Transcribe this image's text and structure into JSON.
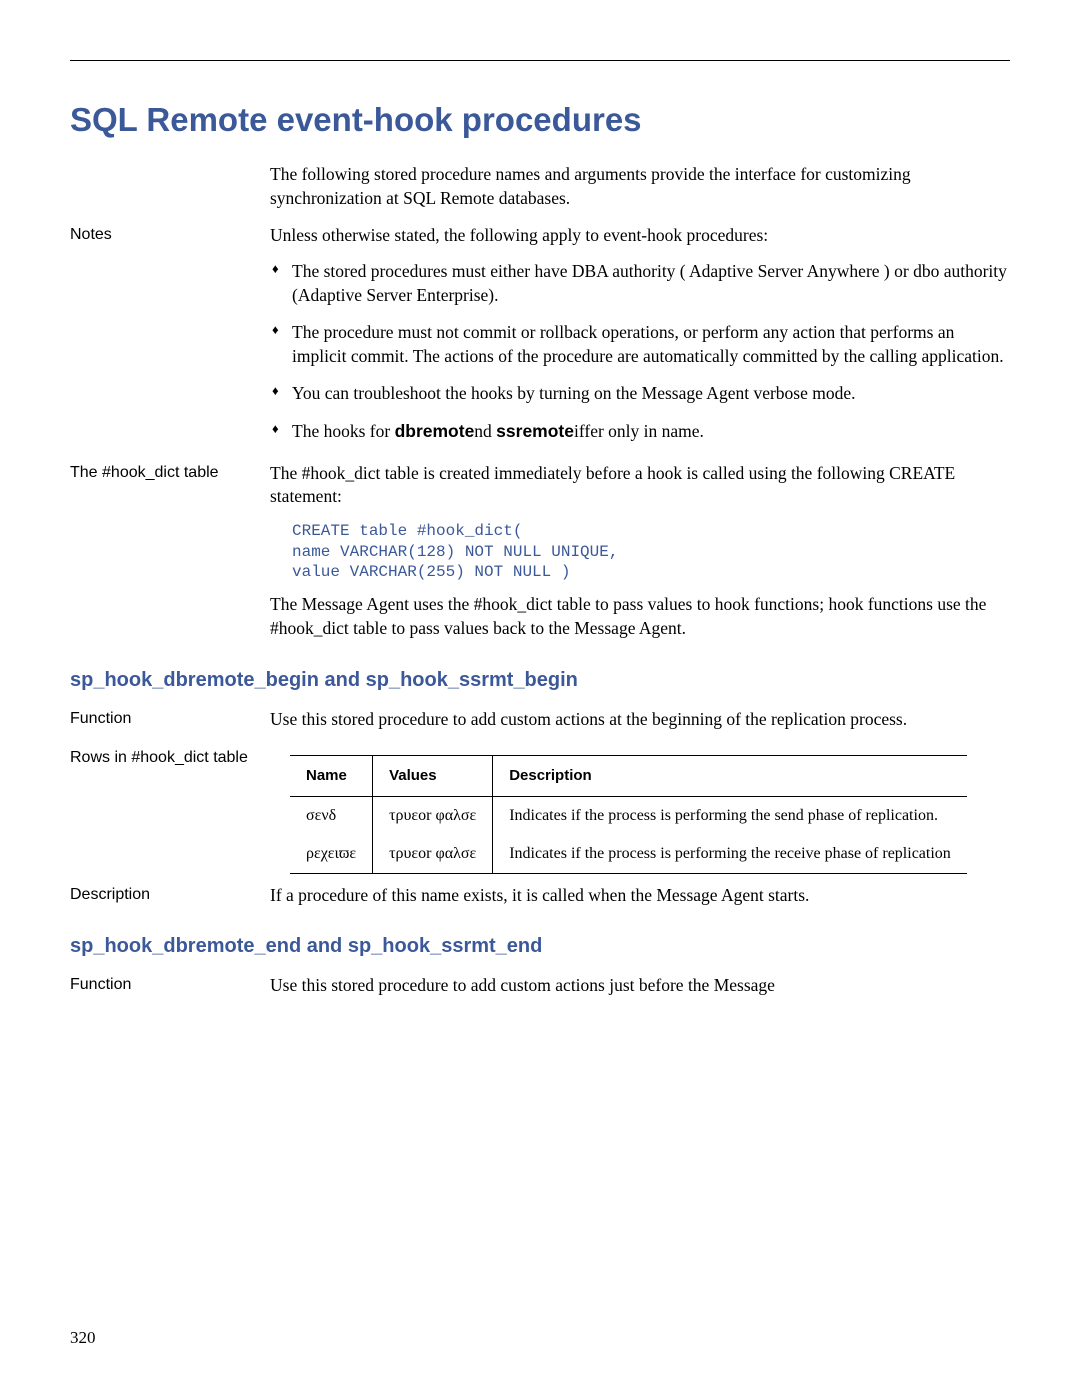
{
  "main_title": "SQL Remote event-hook procedures",
  "intro": "The following stored procedure names and arguments provide the interface for customizing synchronization at SQL Remote databases.",
  "notes": {
    "label": "Notes",
    "lead": "Unless otherwise stated, the following apply to event-hook procedures:",
    "bullets": [
      "The stored procedures must either have DBA authority ( Adaptive Server Anywhere ) or dbo authority (Adaptive Server Enterprise).",
      "The procedure must not commit or rollback operations, or perform any action that performs an implicit commit. The actions of the procedure are automatically committed by the calling application.",
      "You can troubleshoot the hooks by turning on the Message Agent verbose mode."
    ],
    "bullet4_pre": "The hooks for ",
    "bullet4_bold1": "dbremote",
    "bullet4_mid": "nd ",
    "bullet4_bold2": "ssremote",
    "bullet4_post": "iffer only in name."
  },
  "hook_dict": {
    "label": "The #hook_dict table",
    "para1": "The #hook_dict table is created immediately before a hook is called using the following CREATE statement:",
    "code": "CREATE table #hook_dict(\nname VARCHAR(128) NOT NULL UNIQUE,\nvalue VARCHAR(255) NOT NULL )",
    "para2": "The Message Agent uses the #hook_dict table to pass values to hook functions; hook functions use the #hook_dict table to pass values back to the Message Agent."
  },
  "sub1": {
    "title": "sp_hook_dbremote_begin and sp_hook_ssrmt_begin",
    "function_label": "Function",
    "function_text": "Use this stored procedure to add custom actions at the beginning of the replication process.",
    "rows_label": "Rows in #hook_dict table",
    "table": {
      "headers": [
        "Name",
        "Values",
        "Description"
      ],
      "rows": [
        {
          "name": "σενδ",
          "values": "τρυεor φαλσε",
          "desc": "Indicates if the process is performing the send phase of replication."
        },
        {
          "name": "ρεχειϖε",
          "values": "τρυεor φαλσε",
          "desc": "Indicates if the process is performing the receive phase of replication"
        }
      ]
    },
    "desc_label": "Description",
    "desc_text": "If a procedure of this name exists, it is called when the Message Agent starts."
  },
  "sub2": {
    "title": "sp_hook_dbremote_end and sp_hook_ssrmt_end",
    "function_label": "Function",
    "function_text": "Use this stored procedure to add custom actions just before the Message"
  },
  "page_number": "320"
}
